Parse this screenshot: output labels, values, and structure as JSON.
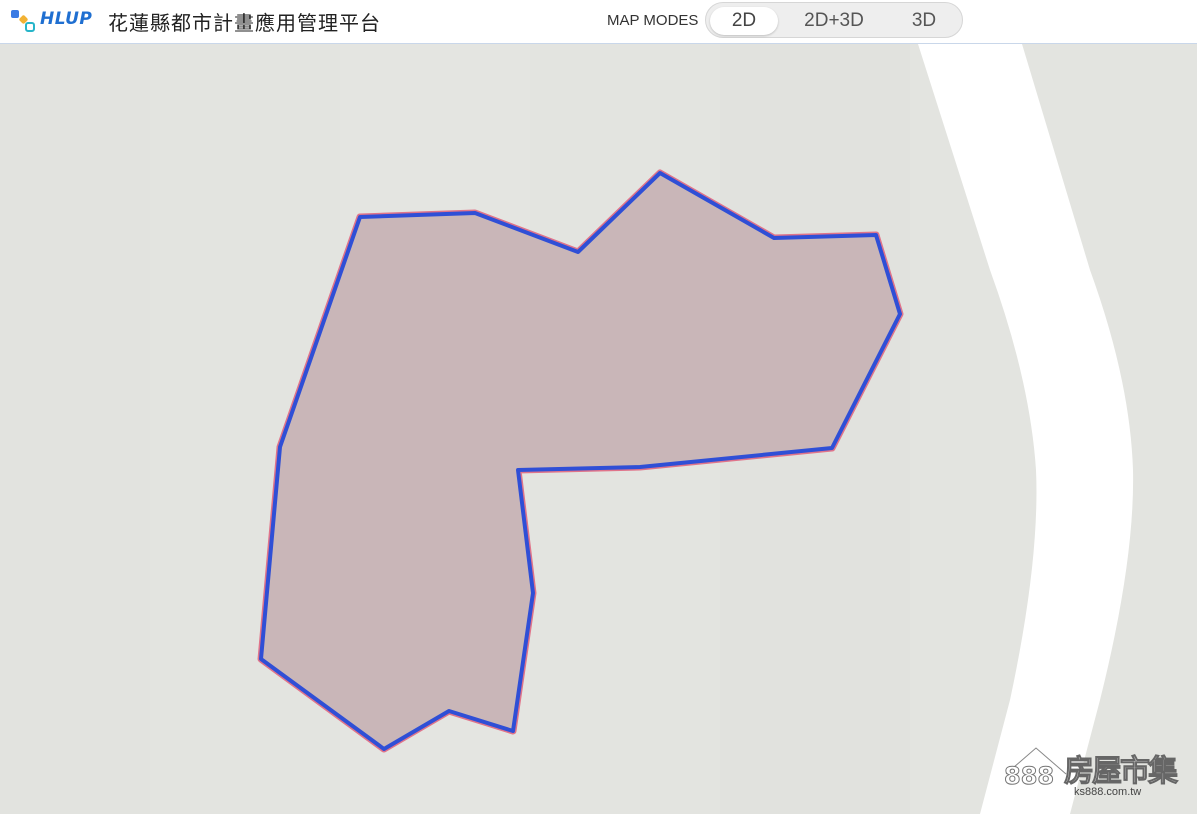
{
  "header": {
    "brand": "HLUP",
    "title": "花蓮縣都市計畫應用管理平台",
    "logo_icon": "hlup-logo-icon"
  },
  "map_modes": {
    "label": "MAP MODES",
    "options": [
      "2D",
      "2D+3D",
      "3D"
    ],
    "selected": "2D"
  },
  "map": {
    "parcel_fill": "#c9b6b8",
    "parcel_outline": "#2f4fd6",
    "parcel_halo": "#e0748a",
    "background": "#e3e4e0",
    "road_color": "#ffffff"
  },
  "watermark": {
    "number": "888",
    "brand": "房屋市集",
    "url": "ks888.com.tw"
  }
}
